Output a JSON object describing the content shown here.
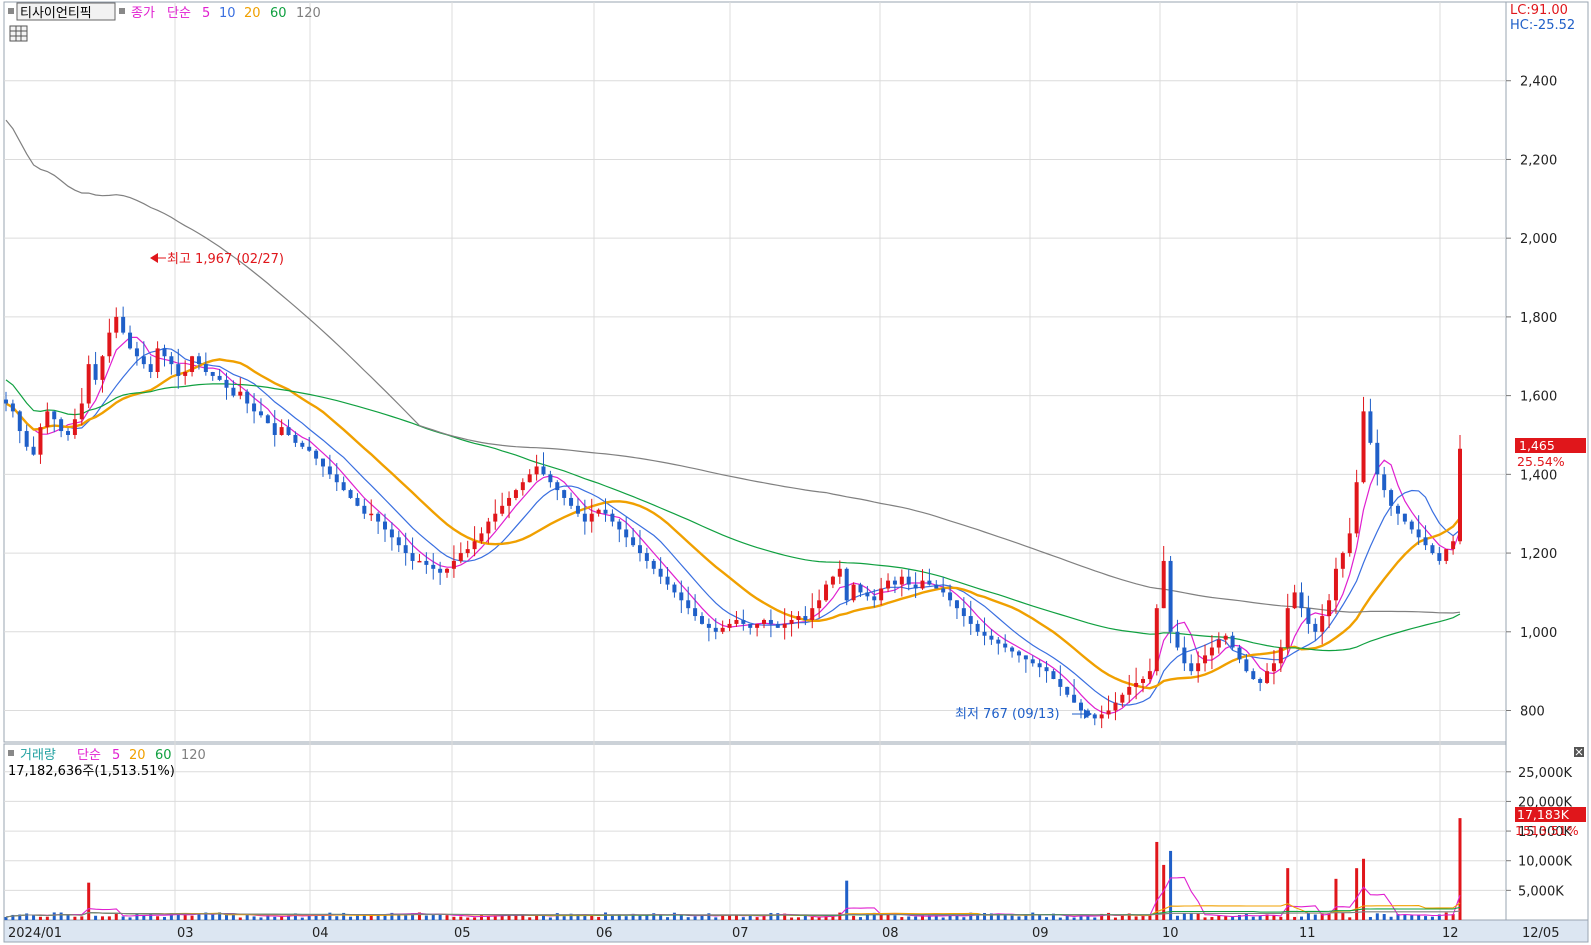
{
  "header": {
    "stock_name": "티사이언티픽",
    "price_label": "종가",
    "ma_type": "단순",
    "ma_periods": [
      "5",
      "10",
      "20",
      "60",
      "120"
    ],
    "ma_colors": [
      "#e020d0",
      "#3a6fe0",
      "#f0a000",
      "#10a040",
      "#808080"
    ]
  },
  "axis_info": {
    "lc": "LC:91.00",
    "hc": "HC:-25.52"
  },
  "price_badge": {
    "value": "1,465",
    "change": "25.54%"
  },
  "annotations": {
    "high": "최고 1,967 (02/27)",
    "low": "최저 767 (09/13)"
  },
  "volume_header": {
    "label": "거래량",
    "ma_type": "단순",
    "ma_periods": [
      "5",
      "20",
      "60",
      "120"
    ],
    "summary": "17,182,636주(1,513.51%)"
  },
  "volume_badge": {
    "value": "17,183K",
    "change": "1513.51%"
  },
  "x_labels": [
    "2024/01",
    "03",
    "04",
    "05",
    "06",
    "07",
    "08",
    "09",
    "10",
    "11",
    "12",
    "12/05"
  ],
  "price_ticks": [
    "2,400",
    "2,200",
    "2,000",
    "1,800",
    "1,600",
    "1,400",
    "1,200",
    "1,000",
    "800"
  ],
  "volume_ticks": [
    "25,000K",
    "20,000K",
    "15,000K",
    "10,000K",
    "5,000K"
  ],
  "colors": {
    "up": "#e0161b",
    "down": "#1f5fc8",
    "badge": "#e0161b"
  },
  "chart_data": {
    "type": "candlestick",
    "period": "2024/01 – 12/05",
    "price_range": [
      720,
      2600
    ],
    "volume_range_k": [
      0,
      28000
    ],
    "high": {
      "price": 1967,
      "date": "02/27"
    },
    "low": {
      "price": 767,
      "date": "09/13"
    },
    "last_close": 1465,
    "last_change_pct": 25.54,
    "last_volume_k": 17183,
    "last_volume_change_pct": 1513.51,
    "close_series": [
      {
        "date": "01",
        "values": [
          1580,
          1560,
          1510,
          1470,
          1450,
          1520,
          1560,
          1540,
          1510,
          1500,
          1540,
          1580,
          1680,
          1640,
          1700,
          1760,
          1800,
          1760,
          1720,
          1700
        ]
      },
      {
        "date": "02",
        "values": [
          1680,
          1660,
          1720,
          1700,
          1680,
          1650,
          1660,
          1700,
          1680,
          1660,
          1650,
          1640,
          1620,
          1600,
          1610,
          1580,
          1560,
          1550,
          1530,
          1500
        ]
      },
      {
        "date": "03",
        "values": [
          1520,
          1500,
          1480,
          1470,
          1460,
          1440,
          1420,
          1400,
          1380,
          1360,
          1340,
          1320,
          1300,
          1300,
          1280,
          1260,
          1240,
          1220,
          1200,
          1180,
          1180
        ]
      },
      {
        "date": "04",
        "values": [
          1170,
          1160,
          1150,
          1160,
          1180,
          1200,
          1210,
          1230,
          1250,
          1280,
          1300,
          1320,
          1340,
          1360,
          1380,
          1400,
          1420,
          1400,
          1380,
          1360
        ]
      },
      {
        "date": "05",
        "values": [
          1340,
          1320,
          1300,
          1280,
          1300,
          1310,
          1300,
          1280,
          1260,
          1240,
          1220,
          1200,
          1180,
          1160,
          1140,
          1120,
          1100,
          1080,
          1060,
          1040,
          1020
        ]
      },
      {
        "date": "06",
        "values": [
          1010,
          1000,
          1010,
          1020,
          1030,
          1020,
          1010,
          1020,
          1030,
          1020,
          1010,
          1020,
          1030,
          1040,
          1030,
          1060,
          1080,
          1120,
          1140,
          1160
        ]
      },
      {
        "date": "07",
        "values": [
          1080,
          1120,
          1100,
          1090,
          1080,
          1110,
          1130,
          1120,
          1140,
          1120,
          1110,
          1130,
          1120,
          1110,
          1100,
          1080,
          1060,
          1040,
          1020,
          1000,
          990,
          980
        ]
      },
      {
        "date": "08",
        "values": [
          970,
          960,
          950,
          940,
          930,
          920,
          910,
          900,
          880,
          860,
          840,
          820,
          800,
          790,
          780,
          790,
          800,
          820,
          840,
          860
        ]
      },
      {
        "date": "09",
        "values": [
          870,
          880,
          900,
          1060,
          1180,
          1000,
          960,
          920,
          900,
          920,
          940,
          960,
          980,
          990,
          960,
          930,
          900,
          880,
          870,
          900
        ]
      },
      {
        "date": "10",
        "values": [
          920,
          960,
          1060,
          1100,
          1060,
          1020,
          1000,
          1040,
          1080,
          1160,
          1200,
          1250,
          1380,
          1560,
          1480,
          1400,
          1360,
          1320,
          1300,
          1280,
          1260
        ]
      },
      {
        "date": "11",
        "values": [
          1240,
          1220,
          1200,
          1180,
          1210,
          1230,
          1465
        ]
      }
    ],
    "moving_averages": [
      {
        "name": "5",
        "color": "#e020d0"
      },
      {
        "name": "10",
        "color": "#3a6fe0"
      },
      {
        "name": "20",
        "color": "#f0a000"
      },
      {
        "name": "60",
        "color": "#10a040"
      },
      {
        "name": "120",
        "color": "#808080"
      }
    ]
  }
}
